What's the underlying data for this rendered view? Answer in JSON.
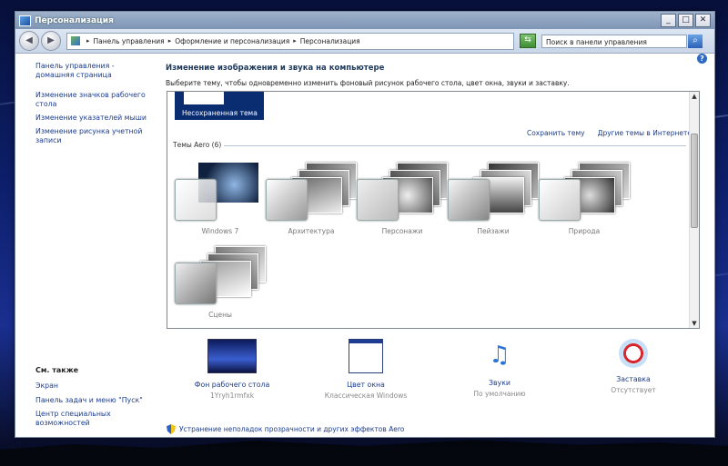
{
  "window": {
    "title": "Персонализация"
  },
  "address": {
    "crumbs": [
      "Панель управления",
      "Оформление и персонализация",
      "Персонализация"
    ],
    "search_placeholder": "Поиск в панели управления"
  },
  "sidebar": {
    "links": [
      {
        "label": "Панель управления - домашняя страница"
      },
      {
        "label": "Изменение значков рабочего стола"
      },
      {
        "label": "Изменение указателей мыши"
      },
      {
        "label": "Изменение рисунка учетной записи"
      }
    ],
    "see_also_title": "См. также",
    "see_also": [
      {
        "label": "Экран"
      },
      {
        "label": "Панель задач и меню \"Пуск\""
      },
      {
        "label": "Центр специальных возможностей"
      }
    ]
  },
  "main": {
    "title": "Изменение изображения и звука на компьютере",
    "subtitle": "Выберите тему, чтобы одновременно изменить фоновый рисунок рабочего стола, цвет окна, звуки и заставку.",
    "unsaved_theme": "Несохраненная тема",
    "save_theme": "Сохранить тему",
    "online_themes": "Другие темы в Интернете",
    "aero_section": "Темы Aero (6)",
    "themes": [
      {
        "name": "Windows 7"
      },
      {
        "name": "Архитектура"
      },
      {
        "name": "Персонажи"
      },
      {
        "name": "Пейзажи"
      },
      {
        "name": "Природа"
      },
      {
        "name": "Сцены"
      }
    ]
  },
  "bottom": [
    {
      "label": "Фон рабочего стола",
      "sub": "1Yryh1rmfxk"
    },
    {
      "label": "Цвет окна",
      "sub": "Классическая Windows"
    },
    {
      "label": "Звуки",
      "sub": "По умолчанию"
    },
    {
      "label": "Заставка",
      "sub": "Отсутствует"
    }
  ],
  "aero_fix": "Устранение неполадок прозрачности и других эффектов Aero"
}
